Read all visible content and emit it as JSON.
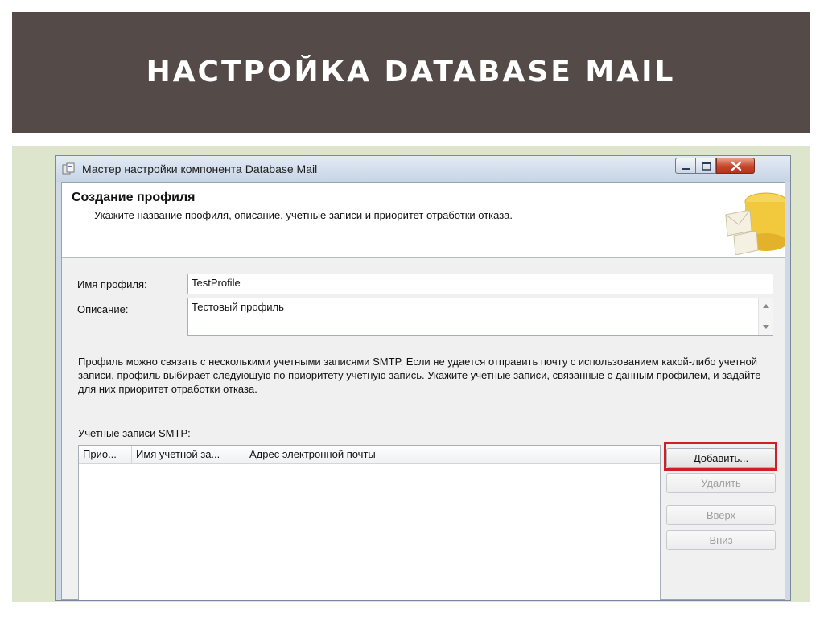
{
  "slide": {
    "title": "НАСТРОЙКА  DATABASE MAIL",
    "accent_color": "#544a47",
    "panel_color": "#dde5cd",
    "highlight_color": "#d01e26"
  },
  "window": {
    "title": "Мастер настройки компонента Database Mail",
    "app_icon": "wizard-app-icon",
    "controls": [
      "minimize-icon",
      "maximize-icon",
      "close-icon"
    ]
  },
  "page": {
    "heading": "Создание профиля",
    "subheading": "Укажите название профиля, описание, учетные записи и приоритет отработки отказа.",
    "icon": "database-mail-wizard-icon"
  },
  "form": {
    "profile_name_label": "Имя профиля:",
    "profile_name_value": "TestProfile",
    "description_label": "Описание:",
    "description_value": "Тестовый профиль"
  },
  "info_text": "Профиль можно связать с несколькими учетными записями SMTP. Если не удается отправить почту с использованием какой-либо учетной записи, профиль выбирает следующую по приоритету учетную запись. Укажите учетные записи, связанные с данным профилем, и задайте для них приоритет отработки отказа.",
  "accounts": {
    "label": "Учетные записи SMTP:",
    "columns": [
      "Прио...",
      "Имя учетной за...",
      "Адрес электронной почты"
    ],
    "rows": []
  },
  "buttons": {
    "add": "Добавить...",
    "remove": "Удалить",
    "up": "Вверх",
    "down": "Вниз"
  }
}
